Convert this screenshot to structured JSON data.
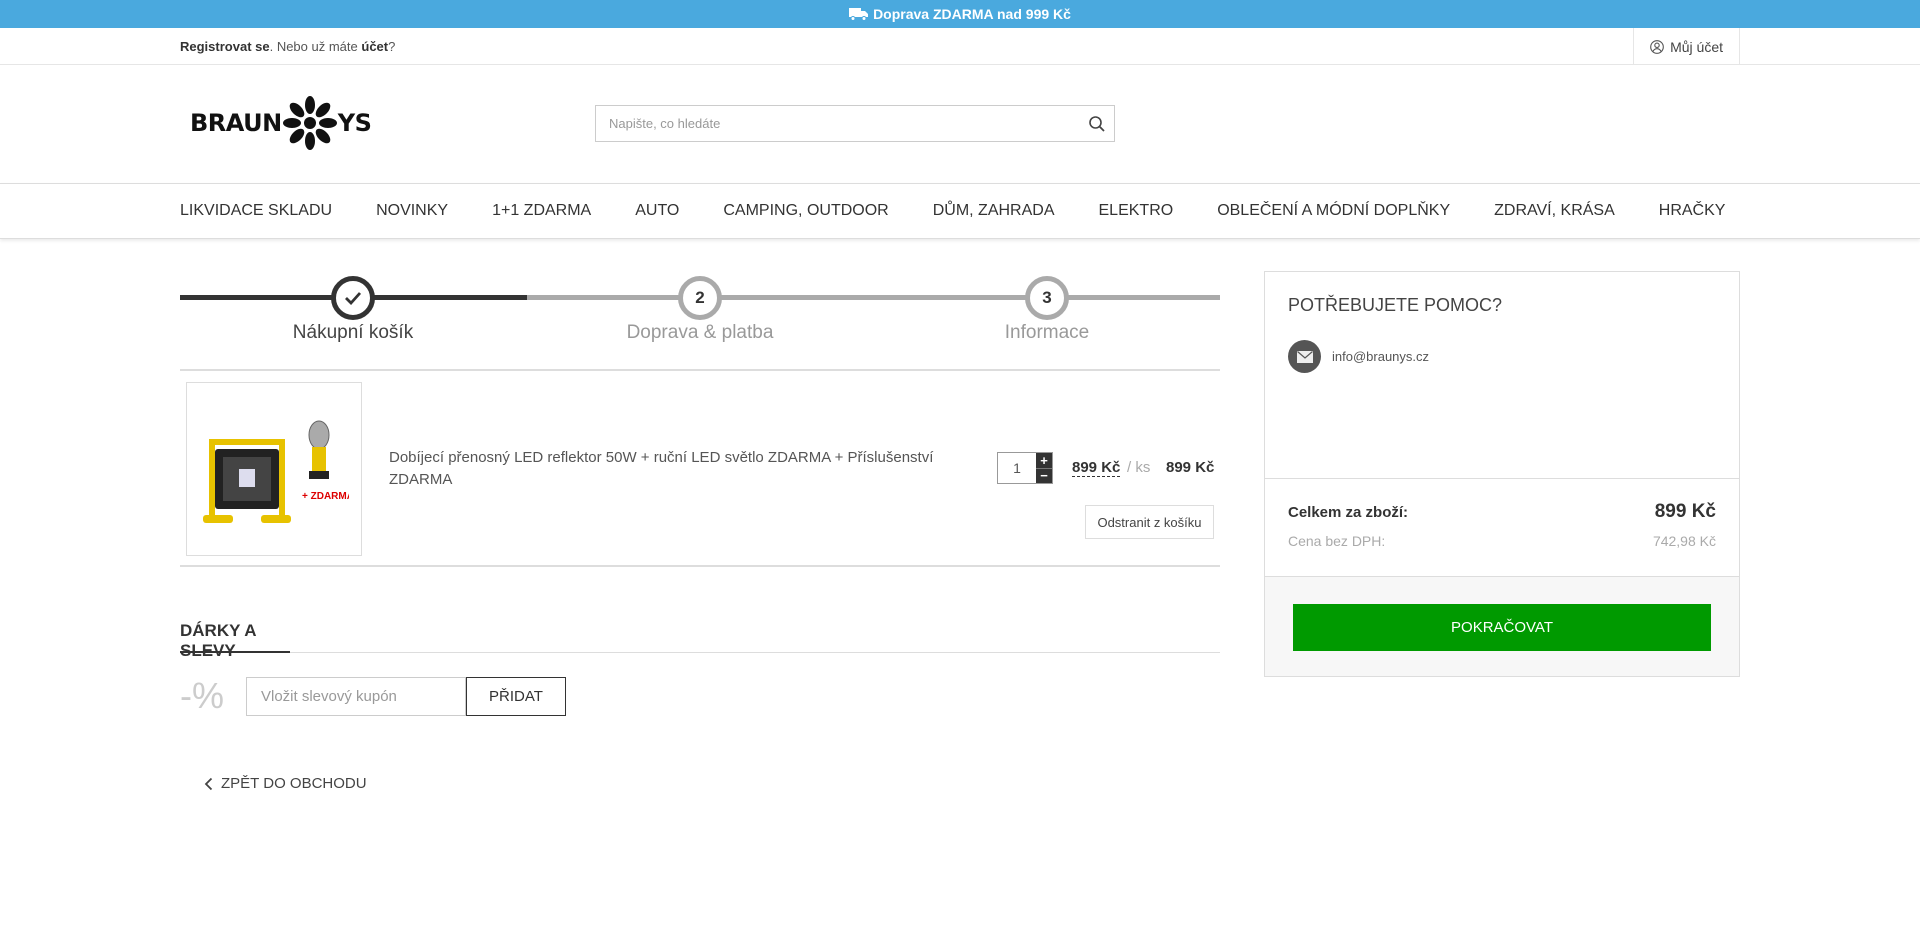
{
  "topbar": {
    "text": "Doprava ZDARMA nad 999 Kč",
    "icon": "truck-icon"
  },
  "userbar": {
    "register": "Registrovat se",
    "middle": ". Nebo už máte ",
    "account_word": "účet",
    "end": "?",
    "my_account": "Můj účet"
  },
  "header": {
    "logo_left": "BRAUN",
    "logo_right": "YS",
    "search_placeholder": "Napište, co hledáte"
  },
  "nav": {
    "items": [
      "LIKVIDACE SKLADU",
      "NOVINKY",
      "1+1 ZDARMA",
      "AUTO",
      "CAMPING, OUTDOOR",
      "DŮM, ZAHRADA",
      "ELEKTRO",
      "OBLEČENÍ A MÓDNÍ DOPLŇKY",
      "ZDRAVÍ, KRÁSA",
      "HRAČKY"
    ]
  },
  "steps": [
    {
      "number": "",
      "label": "Nákupní košík",
      "state": "done"
    },
    {
      "number": "2",
      "label": "Doprava & platba",
      "state": "todo"
    },
    {
      "number": "3",
      "label": "Informace",
      "state": "todo"
    }
  ],
  "cart": {
    "item": {
      "name": "Dobíjecí přenosný LED reflektor 50W + ruční LED světlo ZDARMA + Příslušenství ZDARMA",
      "image_badge": "+ ZDARMA",
      "quantity": "1",
      "unit_price": "899 Kč",
      "per": "/ ks",
      "total": "899 Kč",
      "remove_label": "Odstranit z košíku"
    }
  },
  "gifts": {
    "title": "DÁRKY A SLEVY",
    "percent_sign": "-%",
    "coupon_placeholder": "Vložit slevový kupón",
    "add_label": "PŘIDAT"
  },
  "back_label": "ZPĚT DO OBCHODU",
  "sidebar": {
    "help_title": "POTŘEBUJETE POMOC?",
    "email": "info@braunys.cz",
    "total_label": "Celkem za zboží:",
    "total_value": "899 Kč",
    "net_label": "Cena bez DPH:",
    "net_value": "742,98 Kč",
    "continue_label": "POKRAČOVAT"
  },
  "colors": {
    "topbar": "#4aa9de",
    "continue_button": "#009a00",
    "step_done": "#333333",
    "step_todo": "#aaaaaa"
  }
}
